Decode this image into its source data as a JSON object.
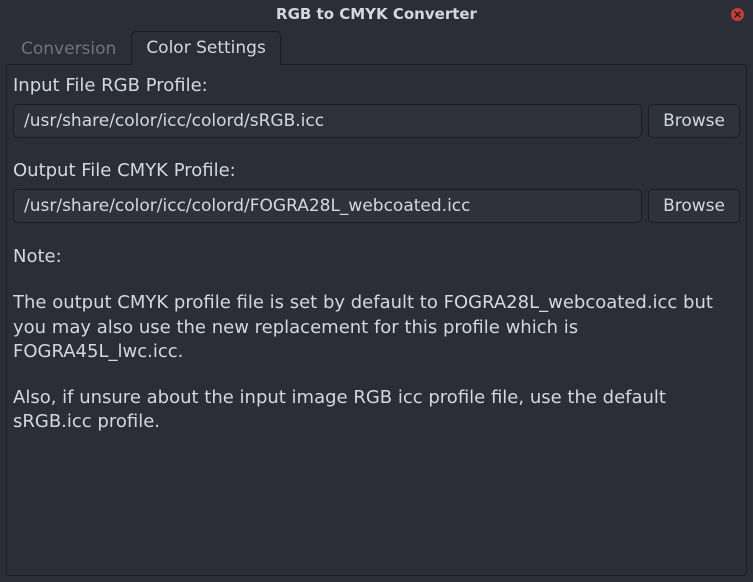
{
  "window": {
    "title": "RGB to CMYK Converter"
  },
  "tabs": {
    "conversion": "Conversion",
    "color_settings": "Color Settings"
  },
  "fields": {
    "input_profile": {
      "label": "Input File RGB Profile:",
      "value": "/usr/share/color/icc/colord/sRGB.icc",
      "browse": "Browse"
    },
    "output_profile": {
      "label": "Output File CMYK Profile:",
      "value": "/usr/share/color/icc/colord/FOGRA28L_webcoated.icc",
      "browse": "Browse"
    }
  },
  "note": {
    "heading": "Note:",
    "p1": "The output CMYK profile file is set by default to FOGRA28L_webcoated.icc but you may also use the new replacement for this profile which is FOGRA45L_lwc.icc.",
    "p2": "Also, if unsure about the input image RGB icc profile file, use the default sRGB.icc profile."
  }
}
